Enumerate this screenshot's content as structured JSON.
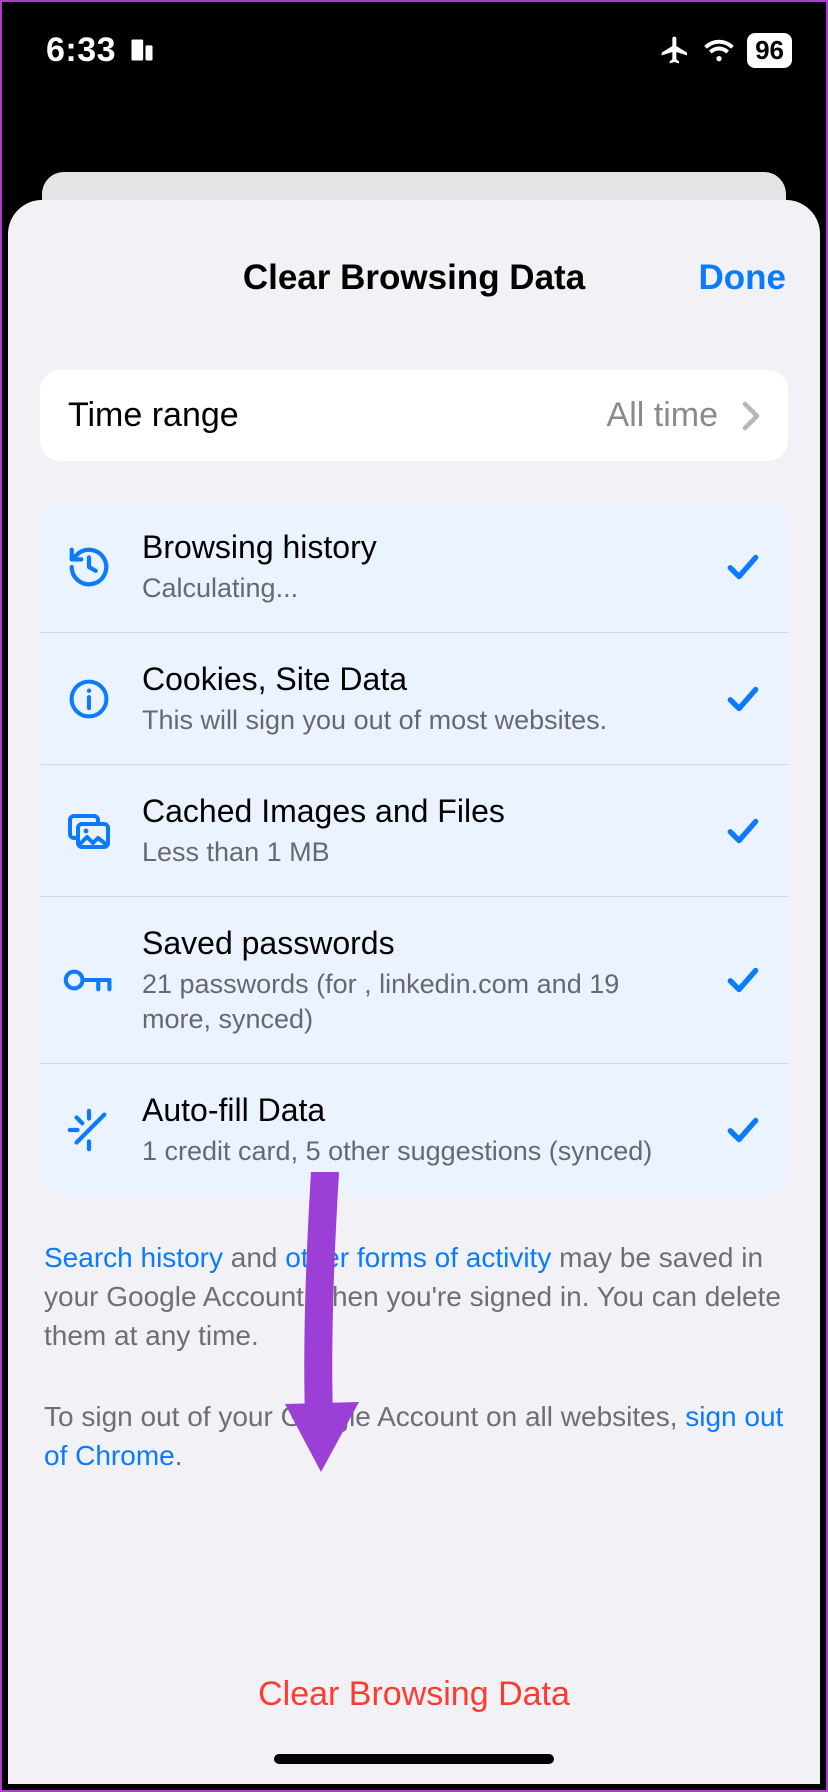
{
  "status_bar": {
    "time": "6:33",
    "battery_pct": "96"
  },
  "header": {
    "title": "Clear Browsing Data",
    "done": "Done"
  },
  "time_range": {
    "label": "Time range",
    "value": "All time"
  },
  "options": [
    {
      "icon": "history",
      "title": "Browsing history",
      "subtitle": "Calculating...",
      "checked": true
    },
    {
      "icon": "info",
      "title": "Cookies, Site Data",
      "subtitle": "This will sign you out of most websites.",
      "checked": true
    },
    {
      "icon": "image",
      "title": "Cached Images and Files",
      "subtitle": "Less than 1 MB",
      "checked": true
    },
    {
      "icon": "key",
      "title": "Saved passwords",
      "subtitle": "21 passwords (for , linkedin.com and 19 more, synced)",
      "checked": true
    },
    {
      "icon": "wand",
      "title": "Auto-fill Data",
      "subtitle": "1 credit card, 5 other suggestions (synced)",
      "checked": true
    }
  ],
  "notices": {
    "line1_link1": "Search history",
    "line1_mid1": " and ",
    "line1_link2": "other forms of activity",
    "line1_rest": " may be saved in your Google Account when you're signed in. You can delete them at any time.",
    "line2_pre": "To sign out of your Google Account on all websites, ",
    "line2_link": "sign out of Chrome",
    "line2_post": "."
  },
  "clear_button": "Clear Browsing Data",
  "colors": {
    "accent": "#0a7aff",
    "destructive": "#ff3b30",
    "arrow": "#9b3fd6"
  }
}
